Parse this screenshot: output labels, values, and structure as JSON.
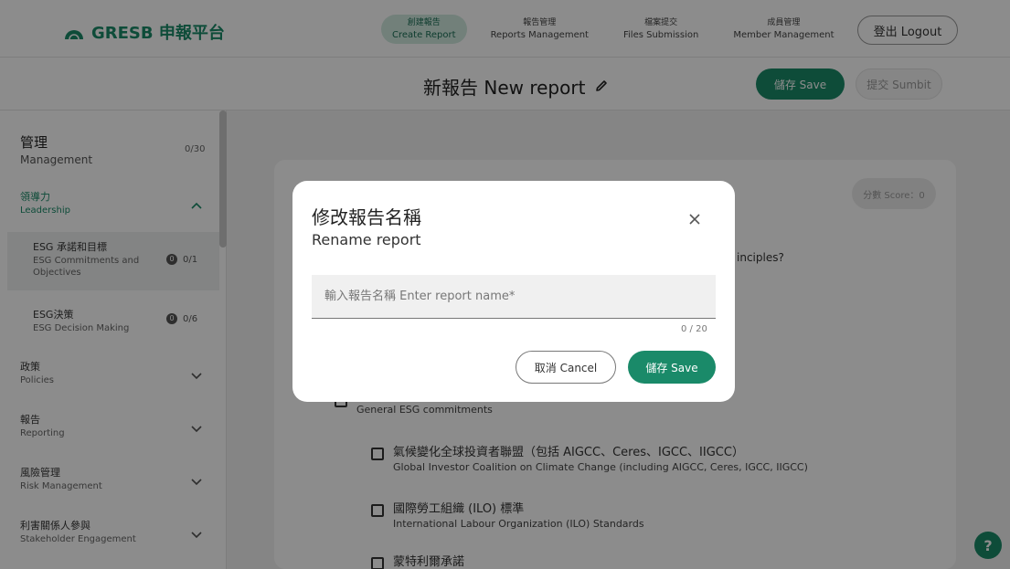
{
  "header": {
    "logo_text": "GRESB 申報平台",
    "nav": [
      {
        "zh": "創建報告",
        "en": "Create Report"
      },
      {
        "zh": "報告管理",
        "en": "Reports Management"
      },
      {
        "zh": "檔案提交",
        "en": "Files Submission"
      },
      {
        "zh": "成員管理",
        "en": "Member Management"
      }
    ],
    "logout_label": "登出 Logout"
  },
  "titlebar": {
    "title": "新報告 New report",
    "save_label": "儲存 Save",
    "submit_label": "提交 Sumbit"
  },
  "sidebar": {
    "group_zh": "管理",
    "group_en": "Management",
    "group_count": "0/30",
    "sections": [
      {
        "zh": "領導力",
        "en": "Leadership"
      },
      {
        "zh": "政策",
        "en": "Policies"
      },
      {
        "zh": "報告",
        "en": "Reporting"
      },
      {
        "zh": "風險管理",
        "en": "Risk Management"
      },
      {
        "zh": "利害關係人參與",
        "en": "Stakeholder Engagement"
      }
    ],
    "items": [
      {
        "zh": "ESG 承諾和目標",
        "en": "ESG Commitments and Objectives",
        "badge": "0",
        "count": "0/1"
      },
      {
        "zh": "ESG決策",
        "en": "ESG Decision Making",
        "badge": "0",
        "count": "0/6"
      }
    ]
  },
  "main": {
    "score_label": "分數 Score：0",
    "question_fragment": "inciples?",
    "options": [
      {
        "zh": "",
        "en": "General ESG commitments"
      },
      {
        "zh": "氣候變化全球投資者聯盟（包括 AIGCC、Ceres、IGCC、IIGCC）",
        "en": "Global Investor Coalition on Climate Change (including AIGCC, Ceres, IGCC, IIGCC)"
      },
      {
        "zh": "國際勞工組織 (ILO) 標準",
        "en": "International Labour Organization (ILO) Standards"
      },
      {
        "zh": "蒙特利爾承諾",
        "en": ""
      }
    ]
  },
  "modal": {
    "title_zh": "修改報告名稱",
    "title_en": "Rename report",
    "input_placeholder": "輸入報告名稱 Enter report name*",
    "char_count": "0 / 20",
    "cancel_label": "取消 Cancel",
    "save_label": "儲存 Save"
  },
  "colors": {
    "brand": "#1a8a69",
    "brand_light": "#cfe9df"
  },
  "icons": {
    "logo": "gresb-logo-icon",
    "edit": "pencil-icon",
    "close": "close-icon",
    "help": "question-icon"
  }
}
